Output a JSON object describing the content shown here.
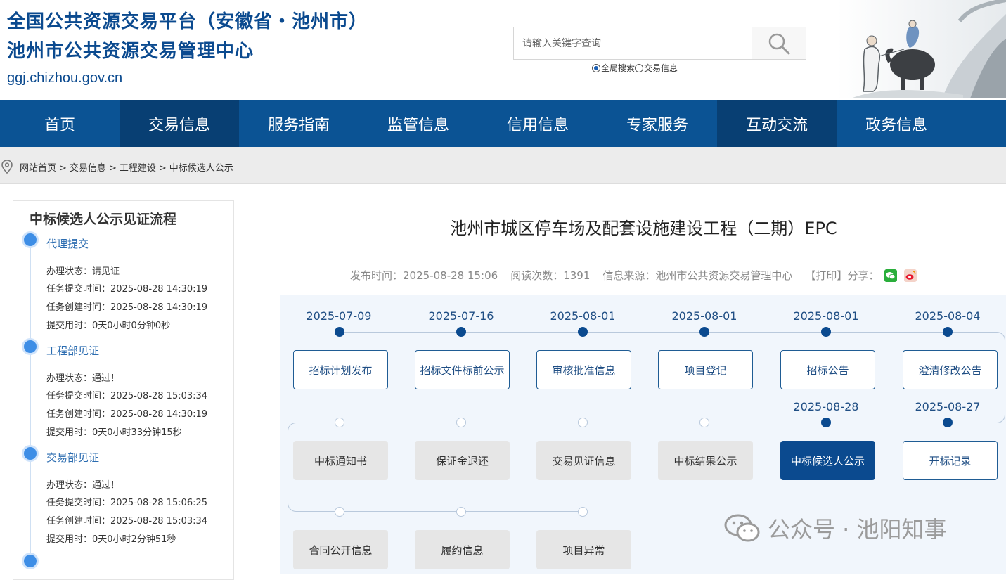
{
  "header": {
    "title_line1": "全国公共资源交易平台（安徽省・池州市）",
    "title_line2": "池州市公共资源交易管理中心",
    "domain": "ggj.chizhou.gov.cn"
  },
  "search": {
    "placeholder": "请输入关键字查询",
    "scope_options": [
      {
        "label": "全局搜索",
        "checked": true
      },
      {
        "label": "交易信息",
        "checked": false
      }
    ]
  },
  "nav": {
    "items": [
      {
        "label": "首页"
      },
      {
        "label": "交易信息",
        "active": true
      },
      {
        "label": "服务指南"
      },
      {
        "label": "监管信息"
      },
      {
        "label": "信用信息"
      },
      {
        "label": "专家服务"
      },
      {
        "label": "互动交流",
        "active": true
      },
      {
        "label": "政务信息"
      }
    ]
  },
  "breadcrumb": [
    "网站首页",
    "交易信息",
    "工程建设",
    "中标候选人公示"
  ],
  "breadcrumb_separator": ">",
  "sidebar": {
    "title": "中标候选人公示见证流程",
    "steps": [
      {
        "name": "代理提交",
        "lines": [
          "办理状态：请见证",
          "任务提交时间：2025-08-28 14:30:19",
          "任务创建时间：2025-08-28 14:30:19",
          "提交用时：0天0小时0分钟0秒"
        ]
      },
      {
        "name": "工程部见证",
        "lines": [
          "办理状态：通过！",
          "任务提交时间：2025-08-28 15:03:34",
          "任务创建时间：2025-08-28 14:30:19",
          "提交用时：0天0小时33分钟15秒"
        ]
      },
      {
        "name": "交易部见证",
        "lines": [
          "办理状态：通过！",
          "任务提交时间：2025-08-28 15:06:25",
          "任务创建时间：2025-08-28 15:03:34",
          "提交用时：0天0小时2分钟51秒"
        ]
      }
    ]
  },
  "article": {
    "title": "池州市城区停车场及配套设施建设工程（二期）EPC",
    "publish_label": "发布时间：",
    "publish_time": "2025-08-28 15:06",
    "views_label": "阅读次数：",
    "views": "1391",
    "source_label": "信息来源：",
    "source": "池州市公共资源交易管理中心",
    "print": "【打印】",
    "share": "分享："
  },
  "timeline": {
    "row1": [
      {
        "date": "2025-07-09",
        "label": "招标计划发布"
      },
      {
        "date": "2025-07-16",
        "label": "招标文件标前公示"
      },
      {
        "date": "2025-08-01",
        "label": "审核批准信息"
      },
      {
        "date": "2025-08-01",
        "label": "项目登记"
      },
      {
        "date": "2025-08-01",
        "label": "招标公告"
      },
      {
        "date": "2025-08-04",
        "label": "澄清修改公告"
      }
    ],
    "row2": [
      {
        "date": "",
        "label": "中标通知书"
      },
      {
        "date": "",
        "label": "保证金退还"
      },
      {
        "date": "",
        "label": "交易见证信息"
      },
      {
        "date": "",
        "label": "中标结果公示"
      },
      {
        "date": "2025-08-28",
        "label": "中标候选人公示"
      },
      {
        "date": "2025-08-27",
        "label": "开标记录"
      }
    ],
    "row3": [
      {
        "label": "合同公开信息"
      },
      {
        "label": "履约信息"
      },
      {
        "label": "项目异常"
      }
    ]
  },
  "watermark": "公众号 · 池阳知事",
  "colors": {
    "primary": "#0b5394",
    "dark_nav": "#083f73",
    "accent": "#3e8ee6"
  }
}
